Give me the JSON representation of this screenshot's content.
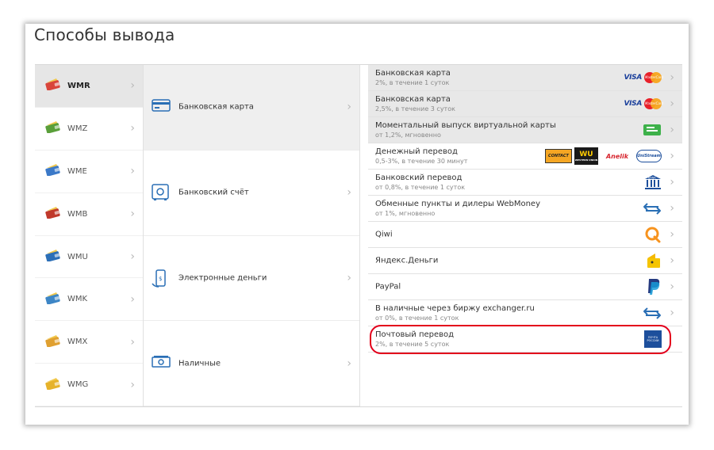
{
  "title": "Способы вывода",
  "purses": [
    {
      "code": "WMR",
      "active": true,
      "color": "#d9453a"
    },
    {
      "code": "WMZ",
      "active": false,
      "color": "#5a9f3a"
    },
    {
      "code": "WME",
      "active": false,
      "color": "#3b79c8"
    },
    {
      "code": "WMB",
      "active": false,
      "color": "#c0392b"
    },
    {
      "code": "WMU",
      "active": false,
      "color": "#2c6fb7"
    },
    {
      "code": "WMK",
      "active": false,
      "color": "#3d86c6"
    },
    {
      "code": "WMX",
      "active": false,
      "color": "#e0a030"
    },
    {
      "code": "WMG",
      "active": false,
      "color": "#e6b22a"
    }
  ],
  "methods": [
    {
      "label": "Банковская карта",
      "icon": "bank-card-icon",
      "active": true
    },
    {
      "label": "Банковский счёт",
      "icon": "safe-icon",
      "active": false
    },
    {
      "label": "Электронные деньги",
      "icon": "phone-money-icon",
      "active": false
    },
    {
      "label": "Наличные",
      "icon": "cash-icon",
      "active": false
    }
  ],
  "options": [
    {
      "title": "Банковская карта",
      "subtitle": "2%, в течение 1 суток",
      "logos": [
        "visa",
        "mastercard"
      ],
      "shaded": true
    },
    {
      "title": "Банковская карта",
      "subtitle": "2,5%, в течение 3 суток",
      "logos": [
        "visa",
        "mastercard"
      ],
      "shaded": true
    },
    {
      "title": "Моментальный выпуск виртуальной карты",
      "subtitle": "от 1,2%, мгновенно",
      "logos": [
        "virtual-card"
      ],
      "shaded": true
    },
    {
      "title": "Денежный перевод",
      "subtitle": "0,5-3%, в течение 30 минут",
      "logos": [
        "contact",
        "western-union",
        "anelik",
        "unistream"
      ],
      "shaded": false
    },
    {
      "title": "Банковский перевод",
      "subtitle": "от 0,8%, в течение 1 суток",
      "logos": [
        "bank-building"
      ],
      "shaded": false
    },
    {
      "title": "Обменные пункты и дилеры WebMoney",
      "subtitle": "от 1%, мгновенно",
      "logos": [
        "exchange-arrows"
      ],
      "shaded": false
    },
    {
      "title": "Qiwi",
      "subtitle": "",
      "logos": [
        "qiwi"
      ],
      "shaded": false
    },
    {
      "title": "Яндекс.Деньги",
      "subtitle": "",
      "logos": [
        "yandex-money"
      ],
      "shaded": false
    },
    {
      "title": "PayPal",
      "subtitle": "",
      "logos": [
        "paypal"
      ],
      "shaded": false
    },
    {
      "title": "В наличные через биржу exchanger.ru",
      "subtitle": "от 0%, в течение 1 суток",
      "logos": [
        "exchange-arrows"
      ],
      "shaded": false
    },
    {
      "title": "Почтовый перевод",
      "subtitle": "2%, в течение 5 суток",
      "logos": [
        "russian-post"
      ],
      "shaded": false,
      "highlighted": true
    }
  ],
  "logo_text": {
    "visa": "VISA",
    "mastercard": "MasterCard",
    "contact": "CONTACT",
    "wu": "WU",
    "wu_sub": "WESTERN UNION",
    "anelik": "Anelik",
    "unistream": "UniStream",
    "bank": "BANK",
    "post": "ПОЧТА РОССИИ"
  },
  "colors": {
    "highlight": "#e3001b",
    "active_bg": "#e6e6e6",
    "brand_blue": "#1a3f9b"
  }
}
